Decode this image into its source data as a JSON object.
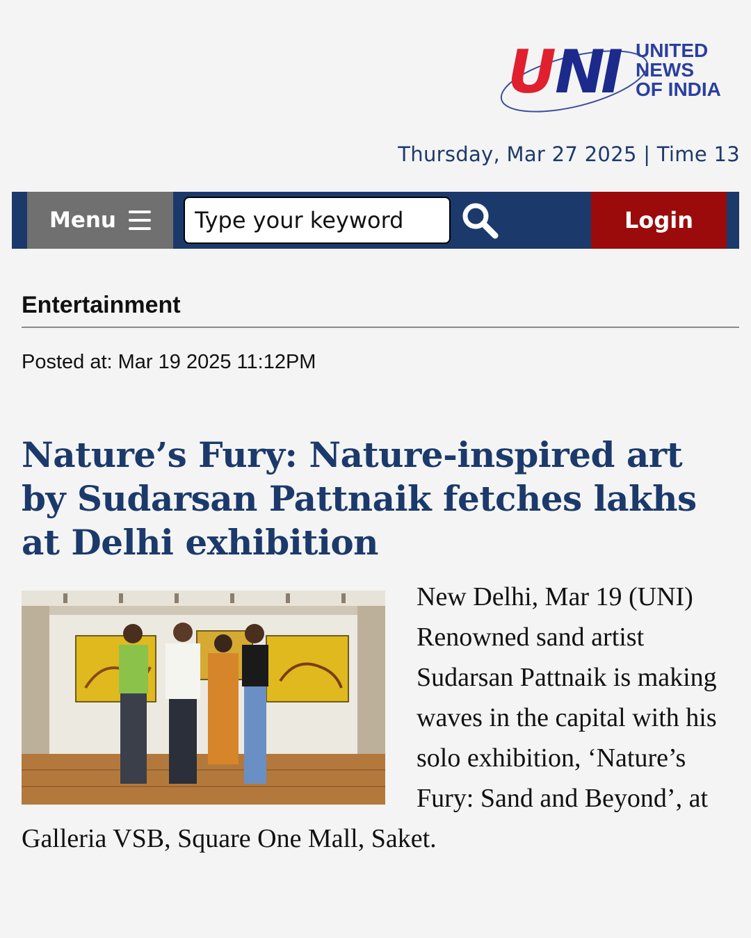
{
  "header": {
    "logo": {
      "mark": "UNI",
      "lines": [
        "UNITED",
        "NEWS",
        "OF INDIA"
      ]
    },
    "date_line": "Thursday, Mar 27 2025 | Time 13"
  },
  "navbar": {
    "menu_label": "Menu",
    "search_placeholder": "Type your keyword",
    "login_label": "Login"
  },
  "article": {
    "category": "Entertainment",
    "posted_at": "Posted at: Mar 19 2025 11:12PM",
    "headline": "Nature’s Fury: Nature-inspired art by Sudarsan Pattnaik fetches lakhs at Delhi exhibition",
    "body": "New Delhi, Mar 19 (UNI) Renowned sand artist Sudarsan Pattnaik is making waves in the capital with his solo exhibition, ‘Nature’s Fury: Sand and Beyond’, at Galleria VSB, Square One Mall, Saket."
  },
  "colors": {
    "brand_navy": "#1b3a6b",
    "brand_red": "#e0202e",
    "login_red": "#9b0b0b",
    "menu_gray": "#707070"
  }
}
